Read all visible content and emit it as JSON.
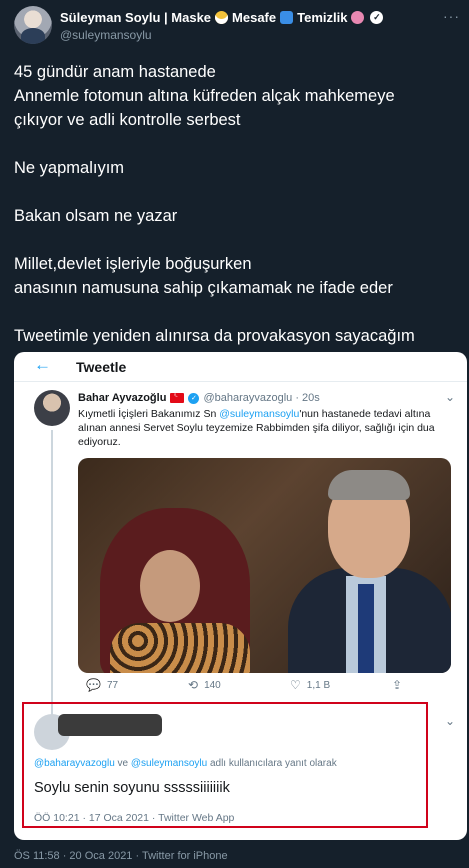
{
  "tweet": {
    "author_name": "Süleyman Soylu | Maske",
    "name_word_2": "Mesafe",
    "name_word_3": "Temizlik",
    "handle": "@suleymansoylu",
    "more_glyph": "···",
    "lines": [
      "45 gündür anam hastanede",
      "Annemle fotomun altına küfreden alçak mahkemeye",
      "çıkıyor ve adli kontrolle serbest",
      "",
      "Ne yapmalıyım",
      "",
      "Bakan olsam ne yazar",
      "",
      "Millet,devlet işleriyle boğuşurken",
      "anasının namusuna sahip çıkamamak ne ifade eder",
      "",
      "Tweetimle yeniden alınırsa da provakasyon sayacağım"
    ],
    "footer": "ÖS 11:58 · 20 Oca 2021 · Twitter for iPhone"
  },
  "screenshot": {
    "back_glyph": "←",
    "title": "Tweetle",
    "quoted": {
      "name": "Bahar Ayvazoğlu",
      "handle_time": "@baharayvazoglu · 20s",
      "text_pre": "Kıymetli İçişleri Bakanımız Sn ",
      "text_mention": "@suleymansoylu",
      "text_post": "'nun hastanede tedavi altına alınan annesi Servet Soylu teyzemize Rabbimden şifa diliyor, sağlığı için dua ediyoruz.",
      "actions": {
        "reply_count": "77",
        "retweet_count": "140",
        "like_count": "1,1 B"
      }
    },
    "reply": {
      "replying_mention_1": "@baharayvazoglu",
      "replying_and": " ve ",
      "replying_mention_2": "@suleymansoylu",
      "replying_suffix": " adlı kullanıcılara yanıt olarak",
      "text": "Soylu senin soyunu sssssiiiiiiik",
      "meta": "ÖÖ 10:21 · 17 Oca 2021 · Twitter Web App"
    }
  },
  "colors": {
    "background": "#15202b",
    "secondary_text": "#8899a6",
    "link": "#1da1f2",
    "highlight_box": "#d0021b"
  }
}
